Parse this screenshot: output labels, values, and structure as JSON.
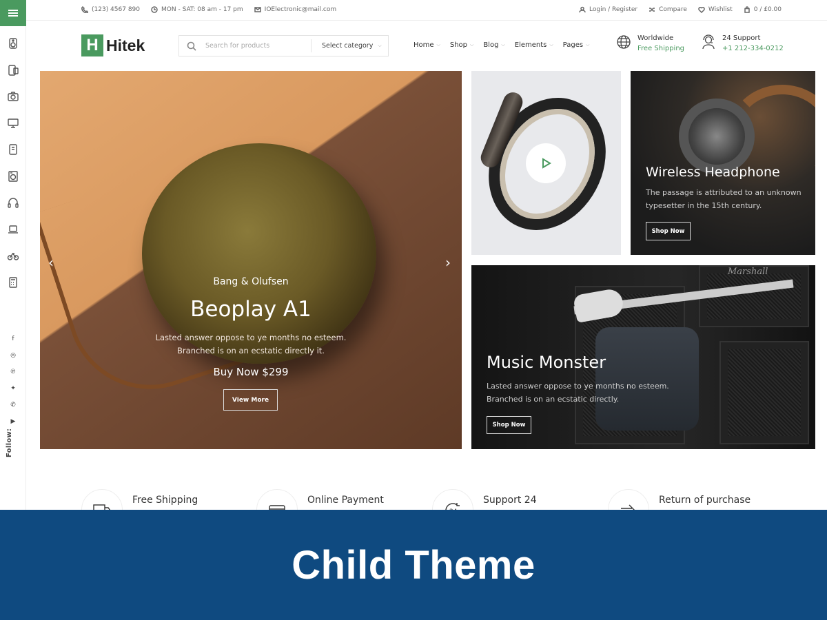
{
  "colors": {
    "accent": "#4a9a5f",
    "banner_bg": "#0f4a80"
  },
  "sidebar": {
    "categories": [
      "speaker-icon",
      "phone-icon",
      "camera-icon",
      "monitor-icon",
      "tablet-icon",
      "washing-machine-icon",
      "headphones-icon",
      "laptop-icon",
      "bicycle-icon",
      "calculator-icon"
    ],
    "social": [
      "f",
      "◎",
      "℗",
      "✦",
      "✆",
      "▶"
    ],
    "follow_label": "Follow:"
  },
  "topbar": {
    "phone": "(123) 4567 890",
    "hours": "MON - SAT: 08 am - 17 pm",
    "email": "IOElectronic@mail.com",
    "login": "Login / Register",
    "compare": "Compare",
    "wishlist": "Wishlist",
    "cart": "0 / £0.00"
  },
  "header": {
    "logo_mark": "H",
    "logo_text": "Hitek",
    "search_placeholder": "Search for products",
    "category_select": "Select category",
    "nav": [
      "Home",
      "Shop",
      "Blog",
      "Elements",
      "Pages"
    ],
    "info1_title": "Worldwide",
    "info1_sub": "Free Shipping",
    "info2_title": "24 Support",
    "info2_sub": "+1 212-334-0212"
  },
  "hero": {
    "subtitle": "Bang & Olufsen",
    "title": "Beoplay A1",
    "desc1": "Lasted answer oppose to ye months no esteem.",
    "desc2": "Branched is on an ecstatic directly it.",
    "price": "Buy Now $299",
    "button": "View More",
    "prev": "‹",
    "next": "›"
  },
  "banner_headphone": {
    "title": "Wireless Headphone",
    "desc1": "The passage is attributed to an unknown",
    "desc2": "typesetter in the 15th century.",
    "button": "Shop Now"
  },
  "banner_music": {
    "title": "Music Monster",
    "desc1": "Lasted answer oppose to ye months no esteem.",
    "desc2": "Branched is on an ecstatic directly.",
    "button": "Shop Now",
    "amp_brand": "Marshall"
  },
  "features": [
    "Free Shipping",
    "Online Payment",
    "Support 24",
    "Return of purchase"
  ],
  "bottom_banner": {
    "title": "Child Theme"
  }
}
